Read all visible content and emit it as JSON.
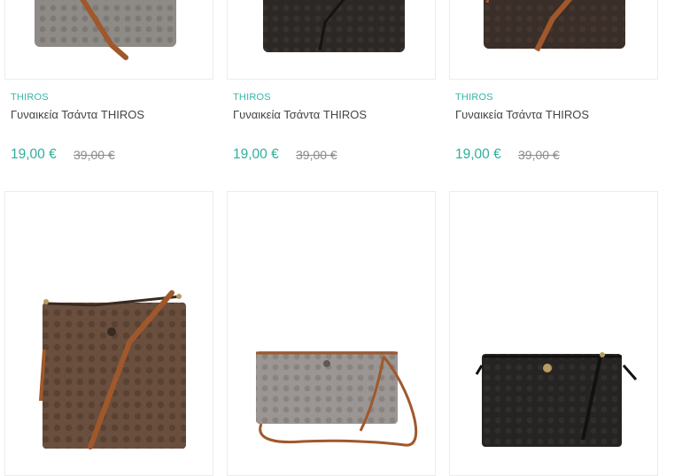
{
  "products_top": [
    {
      "brand": "THIROS",
      "name": "Γυναικεία Τσάντα THIROS",
      "price": "19,00 €",
      "old_price": "39,00 €",
      "bag_color": "#8e8a86"
    },
    {
      "brand": "THIROS",
      "name": "Γυναικεία Τσάντα THIROS",
      "price": "19,00 €",
      "old_price": "39,00 €",
      "bag_color": "#2b2826"
    },
    {
      "brand": "THIROS",
      "name": "Γυναικεία Τσάντα THIROS",
      "price": "19,00 €",
      "old_price": "39,00 €",
      "bag_color": "#3a2e28"
    }
  ],
  "products_bottom": [
    {
      "bag_color": "#6b4f3e"
    },
    {
      "bag_color": "#9b9693"
    },
    {
      "bag_color": "#262422"
    }
  ],
  "colors": {
    "accent": "#34b6a4",
    "strap": "#a0582b"
  }
}
